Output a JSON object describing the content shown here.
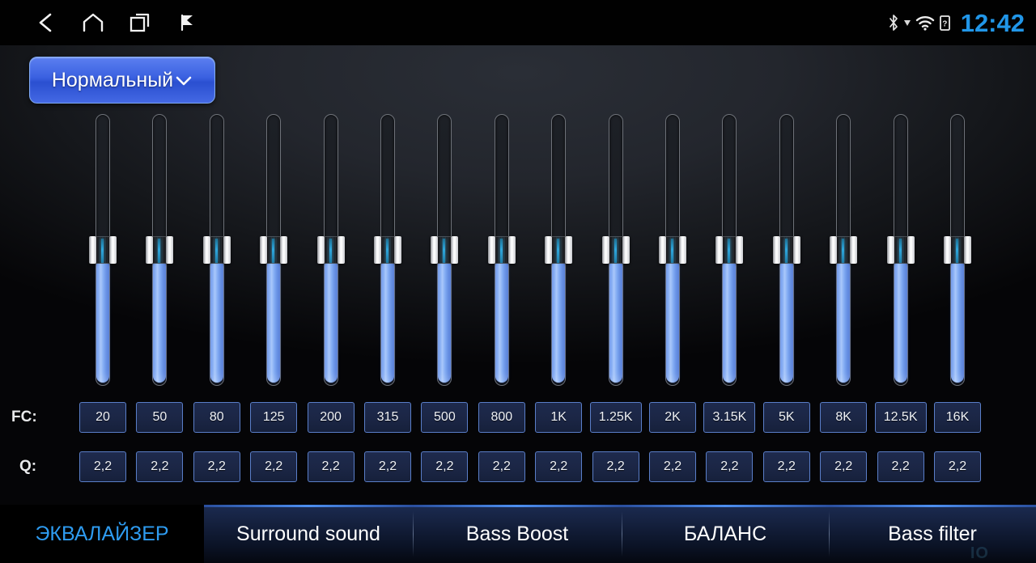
{
  "statusbar": {
    "nav": [
      {
        "name": "back-icon",
        "label": "Back"
      },
      {
        "name": "home-icon",
        "label": "Home"
      },
      {
        "name": "recents-icon",
        "label": "Recent apps"
      },
      {
        "name": "flag-icon",
        "label": "Flag"
      }
    ],
    "icons": [
      {
        "name": "bluetooth-icon",
        "label": "Bluetooth"
      },
      {
        "name": "signal-icon",
        "label": "Signal"
      },
      {
        "name": "wifi-icon",
        "label": "Wi-Fi"
      },
      {
        "name": "sim-unknown-icon",
        "label": "SIM unknown"
      }
    ],
    "clock": "12:42",
    "clock_color": "#2196e8"
  },
  "preset": {
    "label": "Нормальный",
    "chevron": "⌄",
    "accent": "#3a60e0"
  },
  "equalizer": {
    "fc_label": "FC:",
    "q_label": "Q:",
    "bands": [
      {
        "fc": "20",
        "q": "2,2",
        "value": 50
      },
      {
        "fc": "50",
        "q": "2,2",
        "value": 50
      },
      {
        "fc": "80",
        "q": "2,2",
        "value": 50
      },
      {
        "fc": "125",
        "q": "2,2",
        "value": 50
      },
      {
        "fc": "200",
        "q": "2,2",
        "value": 50
      },
      {
        "fc": "315",
        "q": "2,2",
        "value": 50
      },
      {
        "fc": "500",
        "q": "2,2",
        "value": 50
      },
      {
        "fc": "800",
        "q": "2,2",
        "value": 50
      },
      {
        "fc": "1K",
        "q": "2,2",
        "value": 50
      },
      {
        "fc": "1.25K",
        "q": "2,2",
        "value": 50
      },
      {
        "fc": "2K",
        "q": "2,2",
        "value": 50
      },
      {
        "fc": "3.15K",
        "q": "2,2",
        "value": 50
      },
      {
        "fc": "5K",
        "q": "2,2",
        "value": 50
      },
      {
        "fc": "8K",
        "q": "2,2",
        "value": 50
      },
      {
        "fc": "12.5K",
        "q": "2,2",
        "value": 50
      },
      {
        "fc": "16K",
        "q": "2,2",
        "value": 50
      }
    ]
  },
  "tabs": [
    {
      "id": "tab-eq",
      "label": "ЭКВАЛАЙЗЕР",
      "active": true
    },
    {
      "id": "tab-surr",
      "label": "Surround sound",
      "active": false
    },
    {
      "id": "tab-bass",
      "label": "Bass Boost",
      "active": false
    },
    {
      "id": "tab-bal",
      "label": "БАЛАНС",
      "active": false
    },
    {
      "id": "tab-filt",
      "label": "Bass filter",
      "active": false
    }
  ],
  "watermark": "IO"
}
